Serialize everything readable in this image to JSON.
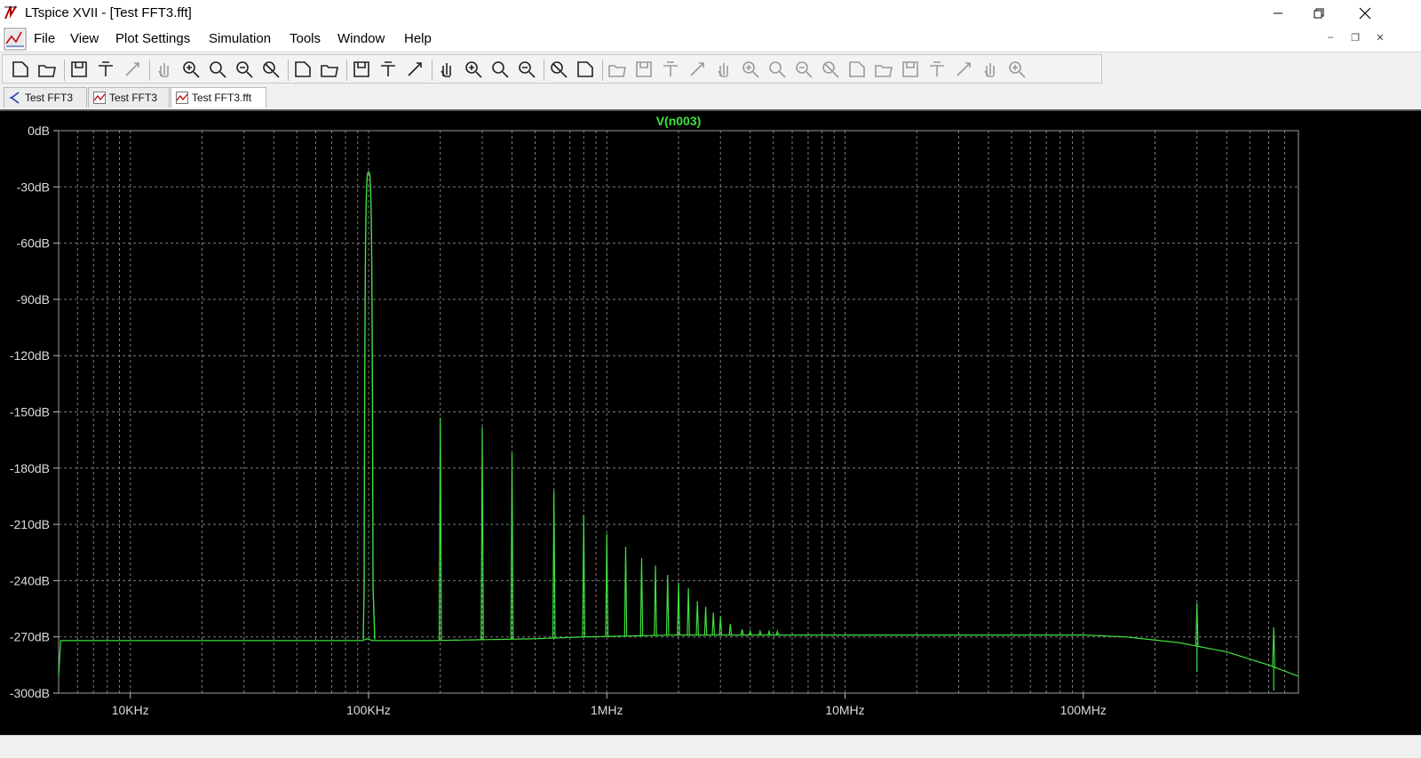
{
  "window": {
    "title": "LTspice XVII - [Test FFT3.fft]"
  },
  "menu": {
    "items": [
      {
        "label": "File",
        "key": "F"
      },
      {
        "label": "View",
        "key": "V"
      },
      {
        "label": "Plot Settings",
        "key": "P"
      },
      {
        "label": "Simulation",
        "key": "S"
      },
      {
        "label": "Tools",
        "key": "T"
      },
      {
        "label": "Window",
        "key": "W"
      },
      {
        "label": "Help",
        "key": "H"
      }
    ]
  },
  "tabs": [
    {
      "label": "Test FFT3",
      "icon": "schematic-icon",
      "active": false
    },
    {
      "label": "Test FFT3",
      "icon": "waveform-icon",
      "active": false
    },
    {
      "label": "Test FFT3.fft",
      "icon": "waveform-icon",
      "active": true
    }
  ],
  "toolbar": {
    "icons": [
      "new-schematic-icon",
      "open-folder-icon",
      "save-icon",
      "control-panel-icon",
      "run-icon",
      "pan-hand-icon",
      "zoom-area-icon",
      "zoom-in-icon",
      "zoom-out-icon",
      "zoom-cancel-icon",
      "autorange-icon",
      "pick-visible-traces-icon",
      "tile-horizontal-icon",
      "tile-vertical-icon",
      "cascade-icon",
      "cut-icon",
      "copy-icon",
      "paste-icon",
      "find-icon",
      "print-preview-icon",
      "print-icon",
      "draw-wire-icon",
      "ground-icon",
      "label-net-icon",
      "resistor-icon",
      "capacitor-icon",
      "inductor-icon",
      "diode-icon",
      "component-icon",
      "move-icon",
      "drag-icon",
      "undo-icon",
      "redo-icon",
      "rotate-icon",
      "mirror-icon",
      "text-icon",
      "spice-directive-icon"
    ]
  },
  "chart_data": {
    "type": "line",
    "title": "V(n003)",
    "xlabel": "",
    "ylabel": "",
    "x_scale": "log",
    "xlim": [
      5000,
      800000000
    ],
    "ylim": [
      -300,
      0
    ],
    "y_ticks": [
      "0dB",
      "-30dB",
      "-60dB",
      "-90dB",
      "-120dB",
      "-150dB",
      "-180dB",
      "-210dB",
      "-240dB",
      "-270dB",
      "-300dB"
    ],
    "x_ticks": [
      "10KHz",
      "100KHz",
      "1MHz",
      "10MHz",
      "100MHz"
    ],
    "grid": true,
    "series": [
      {
        "name": "V(n003)",
        "color": "#3fe03f",
        "noise_floor": [
          [
            5000,
            -272
          ],
          [
            95000,
            -272
          ],
          [
            98000,
            -271
          ],
          [
            104000,
            -272
          ],
          [
            180000,
            -272
          ],
          [
            500000,
            -271
          ],
          [
            800000,
            -270
          ],
          [
            2000000,
            -269
          ],
          [
            10000000,
            -269
          ],
          [
            50000000,
            -269
          ],
          [
            100000000,
            -269
          ],
          [
            150000000,
            -270
          ],
          [
            250000000,
            -273
          ],
          [
            400000000,
            -278
          ],
          [
            600000000,
            -285
          ],
          [
            800000000,
            -291
          ]
        ],
        "fundamental": {
          "f": 100000,
          "db": -22
        },
        "harmonics": [
          {
            "f": 200000,
            "db": -153
          },
          {
            "f": 300000,
            "db": -158
          },
          {
            "f": 400000,
            "db": -172
          },
          {
            "f": 600000,
            "db": -192
          },
          {
            "f": 800000,
            "db": -205
          },
          {
            "f": 1000000,
            "db": -215
          },
          {
            "f": 1200000,
            "db": -222
          },
          {
            "f": 1400000,
            "db": -228
          },
          {
            "f": 1600000,
            "db": -232
          },
          {
            "f": 1800000,
            "db": -237
          },
          {
            "f": 2000000,
            "db": -241
          },
          {
            "f": 2200000,
            "db": -244
          },
          {
            "f": 2400000,
            "db": -251
          },
          {
            "f": 2600000,
            "db": -254
          },
          {
            "f": 2800000,
            "db": -257
          },
          {
            "f": 3000000,
            "db": -259
          },
          {
            "f": 3300000,
            "db": -263
          },
          {
            "f": 3700000,
            "db": -266
          },
          {
            "f": 4000000,
            "db": -267
          },
          {
            "f": 4400000,
            "db": -267
          },
          {
            "f": 4800000,
            "db": -267
          },
          {
            "f": 5200000,
            "db": -267
          },
          {
            "f": 300000000,
            "db": -252
          },
          {
            "f": 630000000,
            "db": -265
          }
        ]
      }
    ]
  }
}
